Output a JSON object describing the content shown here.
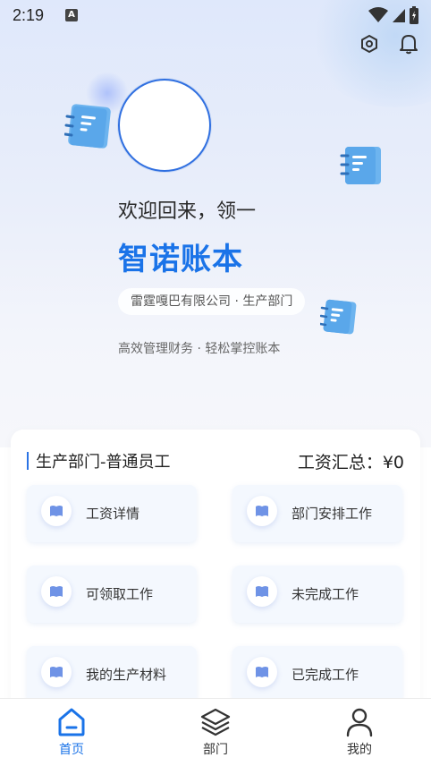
{
  "status_bar": {
    "time": "2:19",
    "notif_letter": "A"
  },
  "hero": {
    "welcome": "欢迎回来，领一",
    "app_name": "智诺账本",
    "company": "雷霆嘎巴有限公司 · 生产部门",
    "slogan": "高效管理财务 · 轻松掌控账本"
  },
  "card": {
    "title": "生产部门-普通员工",
    "salary_total": "工资汇总：¥0",
    "tiles": [
      {
        "label": "工资详情"
      },
      {
        "label": "部门安排工作"
      },
      {
        "label": "可领取工作"
      },
      {
        "label": "未完成工作"
      },
      {
        "label": "我的生产材料"
      },
      {
        "label": "已完成工作"
      }
    ]
  },
  "tabbar": {
    "tabs": [
      {
        "label": "首页",
        "icon": "home-icon",
        "active": true
      },
      {
        "label": "部门",
        "icon": "layers-icon",
        "active": false
      },
      {
        "label": "我的",
        "icon": "user-icon",
        "active": false
      }
    ]
  },
  "colors": {
    "accent": "#1a73e8",
    "active_tab": "#1a73e8",
    "book_icon": "#64b0ee"
  }
}
